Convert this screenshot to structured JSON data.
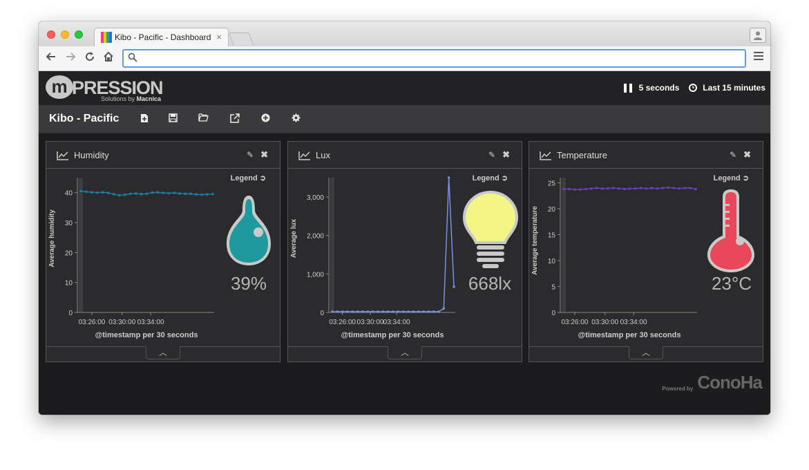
{
  "browser": {
    "tab_title": "Kibo - Pacific - Dashboard",
    "tab_close": "×",
    "url": ""
  },
  "header": {
    "logo_text": "PRESSION",
    "logo_sub_prefix": "Solutions by ",
    "logo_sub_brand": "Macnica",
    "refresh_interval": "5 seconds",
    "time_range": "Last 15 minutes"
  },
  "dashboard": {
    "title": "Kibo - Pacific"
  },
  "panels": [
    {
      "title": "Humidity",
      "legend": "Legend",
      "value": "39%",
      "ylabel": "Average humidity",
      "xlabel": "@timestamp per 30 seconds"
    },
    {
      "title": "Lux",
      "legend": "Legend",
      "value": "668lx",
      "ylabel": "Average lux",
      "xlabel": "@timestamp per 30 seconds"
    },
    {
      "title": "Temperature",
      "legend": "Legend",
      "value": "23°C",
      "ylabel": "Average temperature",
      "xlabel": "@timestamp per 30 seconds"
    }
  ],
  "footer": {
    "powered_by": "Powered by",
    "brand": "ConoHa"
  },
  "chart_data": [
    {
      "type": "line",
      "color": "#1a7fa8",
      "xticks": [
        "03:26:00",
        "03:30:00",
        "03:34:00"
      ],
      "ylim": [
        0,
        45
      ],
      "yticks": [
        0,
        10,
        20,
        30,
        40
      ],
      "values": [
        40.5,
        40.3,
        40.1,
        40.0,
        40.1,
        39.9,
        39.5,
        39.1,
        39.3,
        39.6,
        39.7,
        39.5,
        39.6,
        40.0,
        40.1,
        39.9,
        39.8,
        39.9,
        39.7,
        39.6,
        39.6,
        39.4,
        39.3,
        39.4,
        39.5
      ]
    },
    {
      "type": "line",
      "color": "#7a8fe0",
      "xticks": [
        "03:26:00",
        "03:30:00",
        "03:34:00"
      ],
      "ylim": [
        0,
        3500
      ],
      "yticks": [
        0,
        1000,
        2000,
        3000
      ],
      "yticklabels": [
        "0",
        "1,000",
        "2,000",
        "3,000"
      ],
      "values": [
        20,
        20,
        20,
        20,
        20,
        20,
        20,
        20,
        20,
        20,
        20,
        20,
        20,
        20,
        20,
        20,
        20,
        20,
        20,
        20,
        20,
        20,
        100,
        3500,
        668
      ]
    },
    {
      "type": "line",
      "color": "#6a3fb8",
      "xticks": [
        "03:26:00",
        "03:30:00",
        "03:34:00"
      ],
      "ylim": [
        0,
        26
      ],
      "yticks": [
        0,
        5,
        10,
        15,
        20,
        25
      ],
      "values": [
        23.8,
        23.8,
        23.7,
        23.7,
        23.8,
        23.9,
        24.0,
        23.9,
        23.9,
        24.0,
        23.9,
        23.8,
        23.9,
        23.9,
        24.0,
        23.9,
        24.0,
        23.9,
        24.0,
        24.1,
        24.0,
        23.9,
        24.0,
        24.0,
        23.8
      ]
    }
  ]
}
